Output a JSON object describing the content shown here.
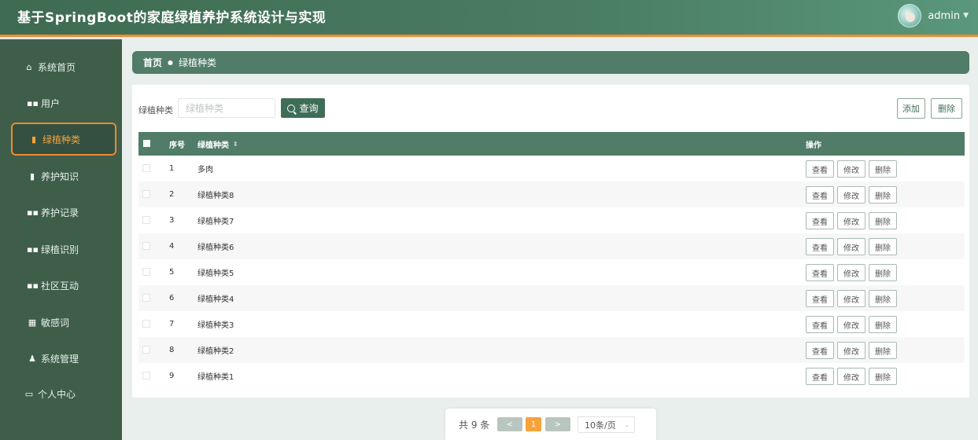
{
  "header": {
    "title": "基于SpringBoot的家庭绿植养护系统设计与实现",
    "username": "admin",
    "caret": "▼"
  },
  "sidebar": {
    "items": [
      {
        "label": "系统首页",
        "icon": "home-icon",
        "glyph": "⌂"
      },
      {
        "label": "用户",
        "icon": "grid-icon",
        "glyph": "▪▪"
      },
      {
        "label": "绿植种类",
        "icon": "clipboard-icon",
        "glyph": "▮"
      },
      {
        "label": "养护知识",
        "icon": "clipboard-icon",
        "glyph": "▮"
      },
      {
        "label": "养护记录",
        "icon": "grid-icon",
        "glyph": "▪▪"
      },
      {
        "label": "绿植识别",
        "icon": "grid-icon",
        "glyph": "▪▪"
      },
      {
        "label": "社区互动",
        "icon": "grid-icon",
        "glyph": "▪▪"
      },
      {
        "label": "敏感词",
        "icon": "table-icon",
        "glyph": "▦"
      },
      {
        "label": "系统管理",
        "icon": "user-icon",
        "glyph": "♟"
      },
      {
        "label": "个人中心",
        "icon": "window-icon",
        "glyph": "▭"
      }
    ],
    "active_index": 2
  },
  "breadcrumb": {
    "home": "首页",
    "separator": "●",
    "current": "绿植种类"
  },
  "search": {
    "label": "绿植种类",
    "placeholder": "绿植种类",
    "button": "查询"
  },
  "actions": {
    "add": "添加",
    "delete": "删除"
  },
  "table": {
    "headers": {
      "index": "序号",
      "name": "绿植种类",
      "sort": "⇕",
      "ops": "操作"
    },
    "rows": [
      {
        "index": "1",
        "name": "多肉"
      },
      {
        "index": "2",
        "name": "绿植种类8"
      },
      {
        "index": "3",
        "name": "绿植种类7"
      },
      {
        "index": "4",
        "name": "绿植种类6"
      },
      {
        "index": "5",
        "name": "绿植种类5"
      },
      {
        "index": "6",
        "name": "绿植种类4"
      },
      {
        "index": "7",
        "name": "绿植种类3"
      },
      {
        "index": "8",
        "name": "绿植种类2"
      },
      {
        "index": "9",
        "name": "绿植种类1"
      }
    ],
    "row_ops": {
      "view": "查看",
      "edit": "修改",
      "remove": "删除"
    }
  },
  "pagination": {
    "total": "共 9 条",
    "prev": "<",
    "current_page": "1",
    "next": ">",
    "page_size": "10条/页"
  },
  "colors": {
    "header": "#4a7d63",
    "sidebar": "#3f5e4a",
    "accent": "#f28a2e",
    "table_header": "#507c68"
  }
}
